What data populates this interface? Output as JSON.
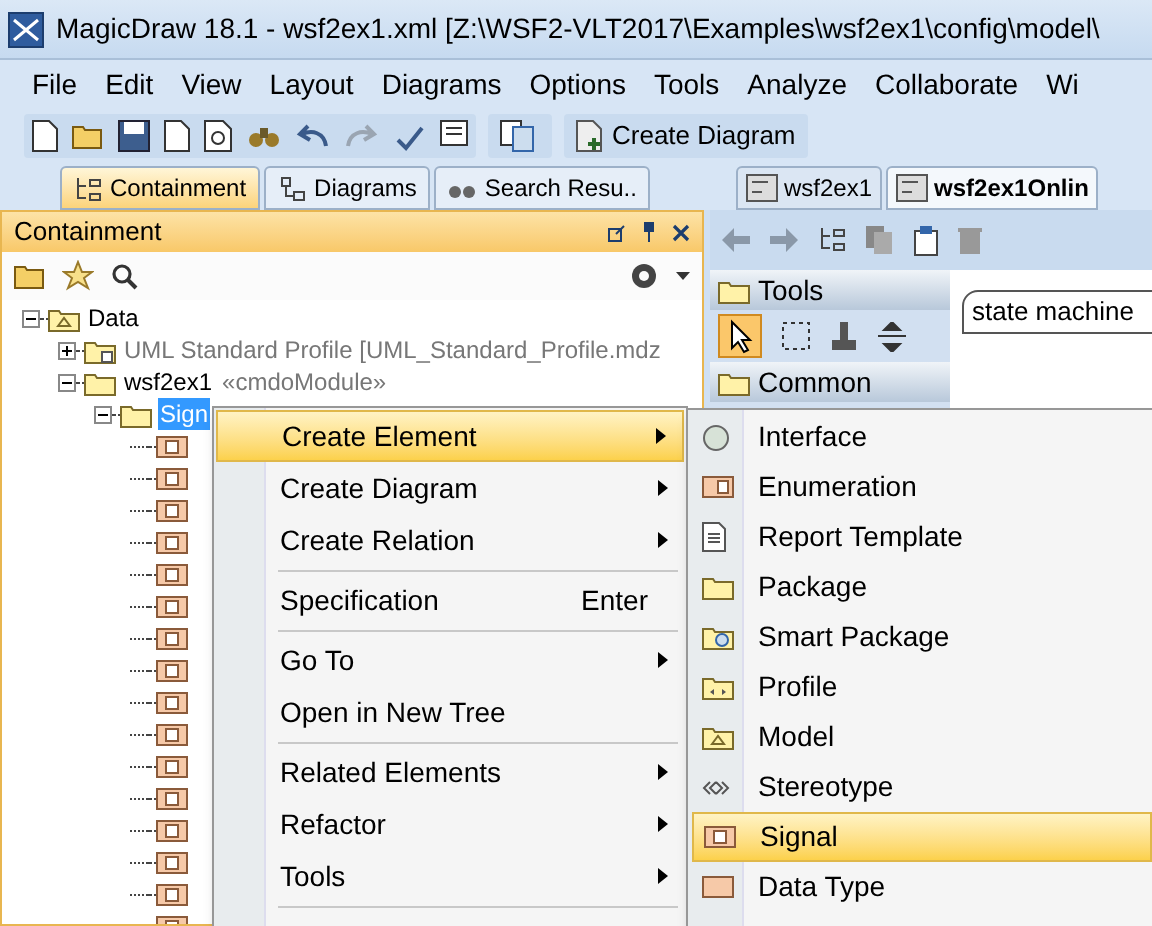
{
  "window": {
    "title": "MagicDraw 18.1 - wsf2ex1.xml [Z:\\WSF2-VLT2017\\Examples\\wsf2ex1\\config\\model\\"
  },
  "menu_bar": [
    "File",
    "Edit",
    "View",
    "Layout",
    "Diagrams",
    "Options",
    "Tools",
    "Analyze",
    "Collaborate",
    "Wi"
  ],
  "toolbar": {
    "button": "Create Diagram"
  },
  "left_tabs": [
    {
      "label": "Containment",
      "selected": true,
      "kind": "tree"
    },
    {
      "label": "Diagrams",
      "selected": false,
      "kind": "diagrams"
    },
    {
      "label": "Search Resu..",
      "selected": false,
      "kind": "search"
    }
  ],
  "panel": {
    "title": "Containment"
  },
  "tree": [
    {
      "label": "Data",
      "kind": "model",
      "expanded": true,
      "children": [
        {
          "label": "UML Standard Profile [UML_Standard_Profile.mdz",
          "kind": "profile",
          "expanded": false,
          "dimmed": true
        },
        {
          "label": "wsf2ex1",
          "stereotype": "«cmdoModule»",
          "kind": "package",
          "expanded": true,
          "children": [
            {
              "label": "Sign",
              "kind": "package",
              "expanded": true,
              "selected": true,
              "children": [
                {
                  "kind": "signal"
                },
                {
                  "kind": "signal"
                },
                {
                  "kind": "signal"
                },
                {
                  "kind": "signal"
                },
                {
                  "kind": "signal"
                },
                {
                  "kind": "signal"
                },
                {
                  "kind": "signal"
                },
                {
                  "kind": "signal"
                },
                {
                  "kind": "signal"
                },
                {
                  "kind": "signal"
                },
                {
                  "kind": "signal"
                },
                {
                  "kind": "signal"
                },
                {
                  "kind": "signal"
                },
                {
                  "kind": "signal"
                },
                {
                  "kind": "signal"
                },
                {
                  "kind": "signal"
                }
              ]
            }
          ]
        }
      ]
    }
  ],
  "editor_tabs": [
    {
      "label": "wsf2ex1",
      "selected": false
    },
    {
      "label": "wsf2ex1Onlin",
      "selected": true
    }
  ],
  "palette": [
    {
      "label": "Tools"
    },
    {
      "label": "Common"
    }
  ],
  "diagram": {
    "title": "state machine"
  },
  "context_menu": [
    {
      "kind": "item",
      "label": "Create Element",
      "submenu": true,
      "selected": true
    },
    {
      "kind": "item",
      "label": "Create Diagram",
      "submenu": true,
      "selected": false
    },
    {
      "kind": "item",
      "label": "Create Relation",
      "submenu": true,
      "selected": false
    },
    {
      "kind": "separator"
    },
    {
      "kind": "item",
      "label": "Specification",
      "shortcut": "Enter",
      "submenu": false,
      "selected": false
    },
    {
      "kind": "separator"
    },
    {
      "kind": "item",
      "label": "Go To",
      "submenu": true,
      "selected": false
    },
    {
      "kind": "item",
      "label": "Open in New Tree",
      "submenu": false,
      "selected": false
    },
    {
      "kind": "separator"
    },
    {
      "kind": "item",
      "label": "Related Elements",
      "submenu": true,
      "selected": false
    },
    {
      "kind": "item",
      "label": "Refactor",
      "submenu": true,
      "selected": false
    },
    {
      "kind": "item",
      "label": "Tools",
      "submenu": true,
      "selected": false
    },
    {
      "kind": "separator"
    }
  ],
  "submenu": [
    {
      "label": "Interface",
      "kind": "interface",
      "selected": false
    },
    {
      "label": "Enumeration",
      "kind": "enumeration",
      "selected": false
    },
    {
      "label": "Report Template",
      "kind": "report",
      "selected": false
    },
    {
      "label": "Package",
      "kind": "package",
      "selected": false
    },
    {
      "label": "Smart Package",
      "kind": "smart",
      "selected": false
    },
    {
      "label": "Profile",
      "kind": "profile",
      "selected": false
    },
    {
      "label": "Model",
      "kind": "model",
      "selected": false
    },
    {
      "label": "Stereotype",
      "kind": "stereotype",
      "selected": false
    },
    {
      "label": "Signal",
      "kind": "signal",
      "selected": true
    },
    {
      "label": "Data Type",
      "kind": "datatype",
      "selected": false
    }
  ]
}
